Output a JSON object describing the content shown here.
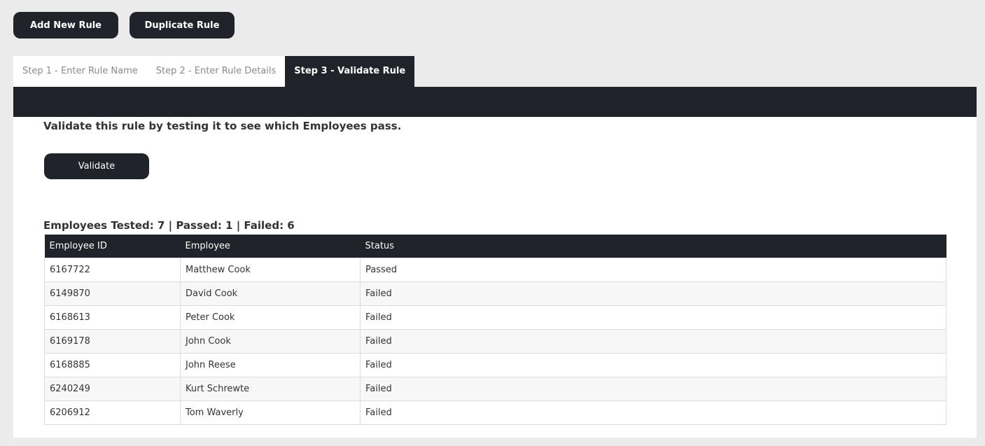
{
  "toolbar": {
    "add_label": "Add New Rule",
    "duplicate_label": "Duplicate Rule"
  },
  "tabs": [
    {
      "label": "Step 1 - Enter Rule Name",
      "active": false
    },
    {
      "label": "Step 2 - Enter Rule Details",
      "active": false
    },
    {
      "label": "Step 3 - Validate Rule",
      "active": true
    }
  ],
  "validate": {
    "intro": "Validate this rule by testing it to see which Employees pass.",
    "button_label": "Validate"
  },
  "results": {
    "summary": "Employees Tested: 7 | Passed: 1 | Failed: 6",
    "columns": [
      "Employee ID",
      "Employee",
      "Status"
    ],
    "rows": [
      {
        "id": "6167722",
        "name": "Matthew Cook",
        "status": "Passed"
      },
      {
        "id": "6149870",
        "name": "David Cook",
        "status": "Failed"
      },
      {
        "id": "6168613",
        "name": "Peter Cook",
        "status": "Failed"
      },
      {
        "id": "6169178",
        "name": "John Cook",
        "status": "Failed"
      },
      {
        "id": "6168885",
        "name": "John Reese",
        "status": "Failed"
      },
      {
        "id": "6240249",
        "name": "Kurt Schrewte",
        "status": "Failed"
      },
      {
        "id": "6206912",
        "name": "Tom Waverly",
        "status": "Failed"
      }
    ]
  },
  "colors": {
    "dark": "#202329",
    "page_bg": "#ebebeb",
    "panel_bg": "#ffffff"
  }
}
